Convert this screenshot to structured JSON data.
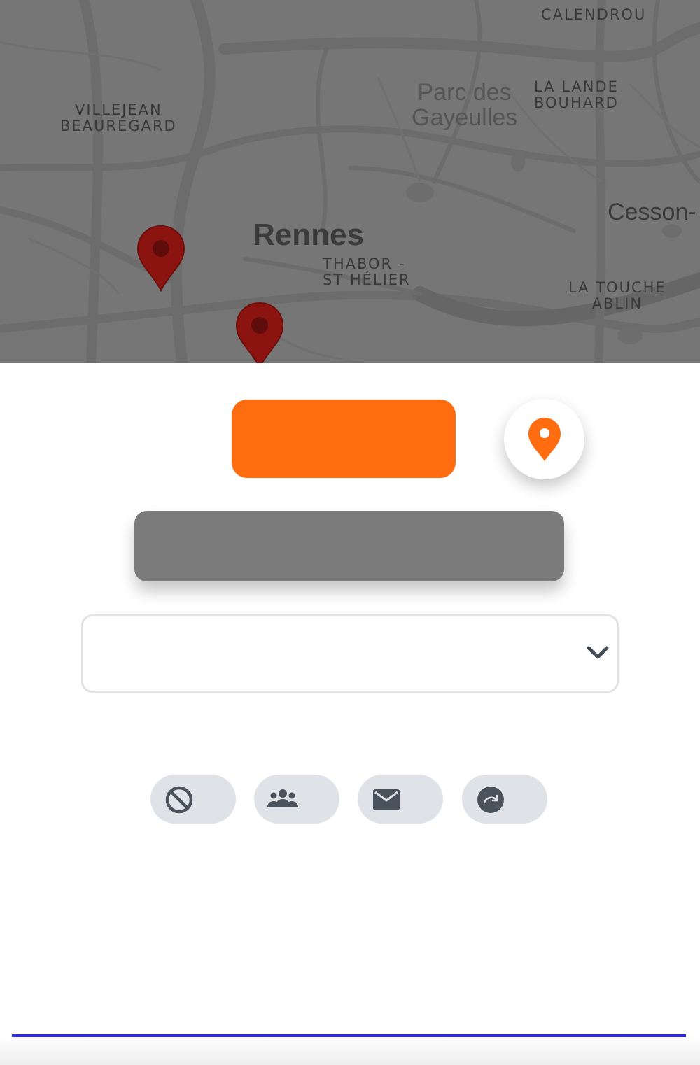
{
  "map": {
    "labels": {
      "calendrou": "CALENDROU",
      "villejean": "VILLEJEAN\nBEAUREGARD",
      "parc": "Parc des\nGayeulles",
      "lande": "LA LANDE\nBOUHARD",
      "rennes": "Rennes",
      "cesson": "Cesson-",
      "thabor": "THABOR -\nST HÉLIER",
      "touche": "LA TOUCHE\nABLIN"
    },
    "marker_color": "#8b1410"
  },
  "actions": {
    "primary_label": "",
    "secondary_label": "",
    "accent_color": "#ff6d10"
  },
  "select": {
    "value": ""
  },
  "chips": [
    {
      "icon": "block-icon"
    },
    {
      "icon": "group-icon"
    },
    {
      "icon": "mail-icon"
    },
    {
      "icon": "redo-icon"
    }
  ]
}
